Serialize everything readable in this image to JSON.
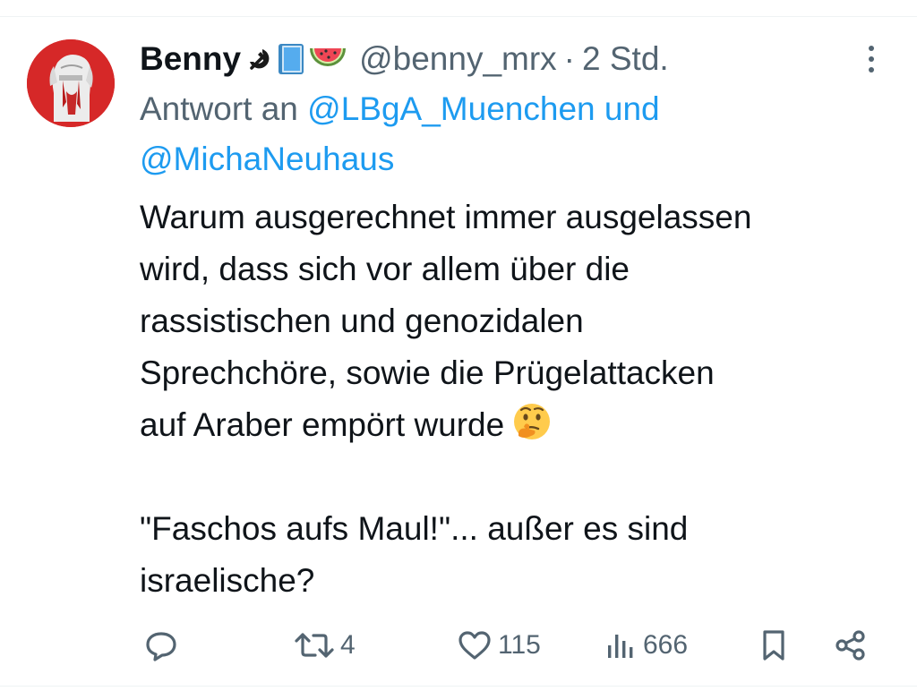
{
  "tweet": {
    "display_name": "Benny",
    "name_emojis": [
      "hammer-sickle-icon",
      "blue-book-icon",
      "watermelon-icon"
    ],
    "handle": "@benny_mrx",
    "separator": "·",
    "time": "2 Std.",
    "reply_prefix": "Antwort an",
    "reply_mention_1": "@LBgA_Muenchen",
    "reply_joiner": "und",
    "reply_mention_2": "@MichaNeuhaus",
    "body_lines": [
      "Warum ausgerechnet immer ausgelassen",
      "wird, dass sich vor allem über die",
      "rassistischen und genozidalen",
      "Sprechchöre, sowie die Prügelattacken",
      "auf Araber empört wurde"
    ],
    "body_emoji": "thinking-face-icon",
    "quote_lines": [
      "\"Faschos aufs Maul!\"... außer es sind",
      "israelische?"
    ]
  },
  "actions": {
    "reply_count": "",
    "retweet_count": "4",
    "like_count": "115",
    "views_count": "666"
  },
  "colors": {
    "text": "#0f1419",
    "secondary": "#536471",
    "link": "#1d9bf0",
    "avatar_bg": "#d62828"
  }
}
